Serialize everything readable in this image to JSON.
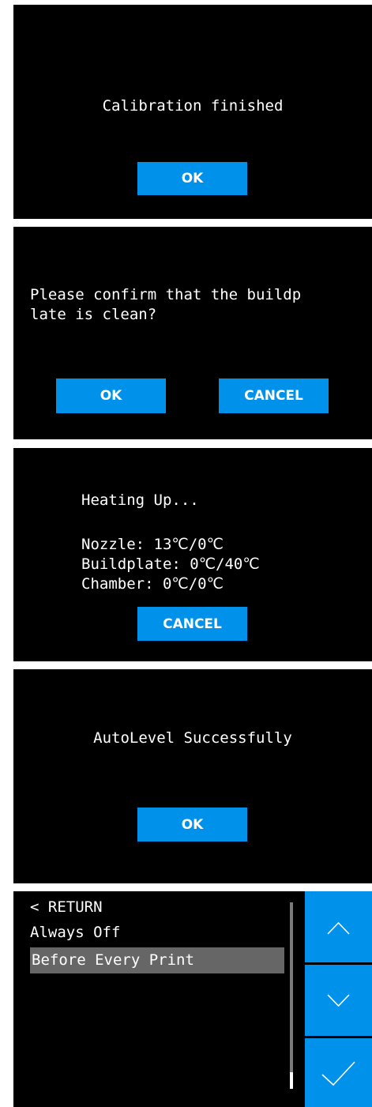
{
  "screens": {
    "calibration": {
      "message": "Calibration finished",
      "ok_label": "OK"
    },
    "confirm_clean": {
      "message": "Please confirm that the buildp\nlate is clean?",
      "ok_label": "OK",
      "cancel_label": "CANCEL"
    },
    "heating": {
      "title": "Heating Up...",
      "nozzle": "Nozzle: 13℃/0℃",
      "buildplate": "Buildplate: 0℃/40℃",
      "chamber": "Chamber: 0℃/0℃",
      "cancel_label": "CANCEL"
    },
    "autolevel": {
      "message": "AutoLevel Successfully",
      "ok_label": "OK"
    },
    "menu": {
      "items": [
        {
          "label": "< RETURN"
        },
        {
          "label": "Always Off"
        },
        {
          "label": "Before Every Print",
          "selected": true
        }
      ],
      "side_buttons": [
        "chevron-up-icon",
        "chevron-down-icon",
        "checkmark-icon"
      ]
    }
  },
  "colors": {
    "accent": "#0091EA",
    "panel_bg": "#000000",
    "selected_bg": "#666666",
    "text": "#FFFFFF"
  }
}
